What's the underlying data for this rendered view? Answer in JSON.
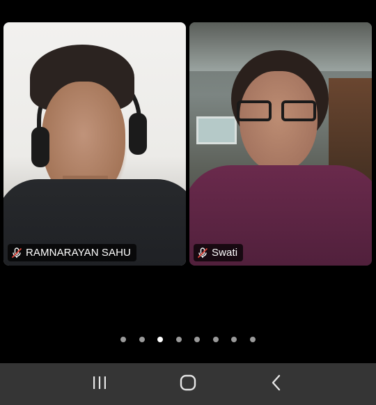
{
  "participants": [
    {
      "name": "RAMNARAYAN SAHU",
      "muted": true,
      "mic_icon": "mic-muted-icon"
    },
    {
      "name": "Swati",
      "muted": true,
      "mic_icon": "mic-muted-icon"
    }
  ],
  "pager": {
    "count": 8,
    "active_index": 2
  },
  "navbar": {
    "buttons": [
      "recent-apps",
      "home",
      "back"
    ]
  },
  "colors": {
    "background": "#000000",
    "navbar": "#353535",
    "dot_inactive": "#9a9a9a",
    "dot_active": "#ffffff"
  }
}
